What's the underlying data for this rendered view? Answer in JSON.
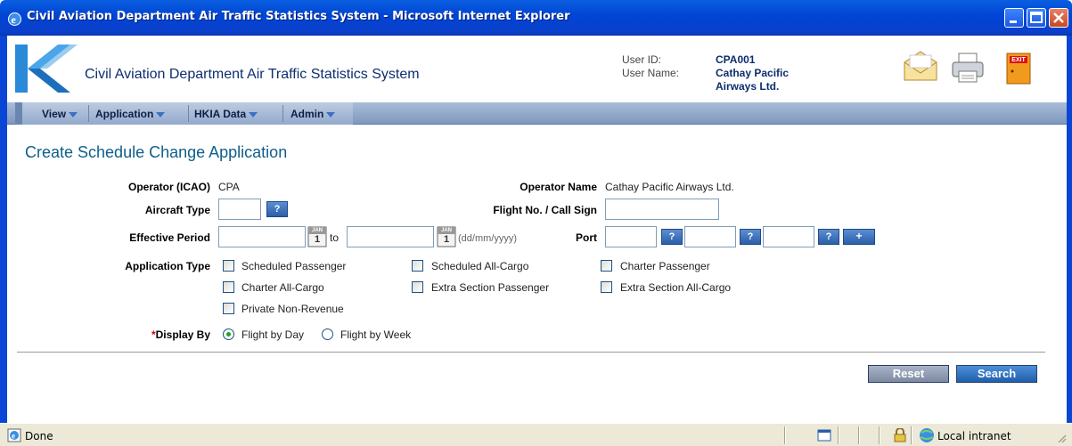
{
  "window": {
    "title": "Civil Aviation Department Air Traffic Statistics System - Microsoft Internet Explorer"
  },
  "header": {
    "app_title": "Civil Aviation Department Air Traffic Statistics System",
    "user_id_label": "User ID:",
    "user_id": "CPA001",
    "user_name_label": "User Name:",
    "user_name_line1": "Cathay Pacific",
    "user_name_line2": "Airways Ltd.",
    "exit_label": "EXIT"
  },
  "menu": {
    "items": [
      {
        "label": "View"
      },
      {
        "label": "Application"
      },
      {
        "label": "HKIA Data"
      },
      {
        "label": "Admin"
      }
    ]
  },
  "form": {
    "title": "Create Schedule Change Application",
    "operator_icao_label": "Operator (ICAO)",
    "operator_icao": "CPA",
    "operator_name_label": "Operator Name",
    "operator_name": "Cathay Pacific Airways Ltd.",
    "aircraft_type_label": "Aircraft Type",
    "aircraft_type_value": "",
    "flight_no_label": "Flight No. / Call Sign",
    "flight_no_value": "",
    "effective_period_label": "Effective Period",
    "effective_from": "",
    "effective_to": "",
    "to_label": "to",
    "date_format_hint": "(dd/mm/yyyy)",
    "calendar_month": "JAN",
    "calendar_day": "1",
    "port_label": "Port",
    "port_values": [
      "",
      "",
      ""
    ],
    "lookup_button": "?",
    "add_port_button": "+",
    "application_type_label": "Application Type",
    "application_types": [
      {
        "label": "Scheduled Passenger",
        "checked": false
      },
      {
        "label": "Scheduled All-Cargo",
        "checked": false
      },
      {
        "label": "Charter Passenger",
        "checked": false
      },
      {
        "label": "Charter All-Cargo",
        "checked": false
      },
      {
        "label": "Extra Section Passenger",
        "checked": false
      },
      {
        "label": "Extra Section All-Cargo",
        "checked": false
      },
      {
        "label": "Private Non-Revenue",
        "checked": false
      }
    ],
    "required_marker": "*",
    "display_by_label": "Display By",
    "display_options": [
      {
        "label": "Flight by Day",
        "selected": true
      },
      {
        "label": "Flight by Week",
        "selected": false
      }
    ],
    "reset_label": "Reset",
    "search_label": "Search"
  },
  "statusbar": {
    "status": "Done",
    "zone": "Local intranet"
  },
  "colors": {
    "accent": "#0e5e8a",
    "menu_bar": "#93aacb",
    "search_button": "#1f5fae",
    "reset_button": "#7d8aa2"
  }
}
